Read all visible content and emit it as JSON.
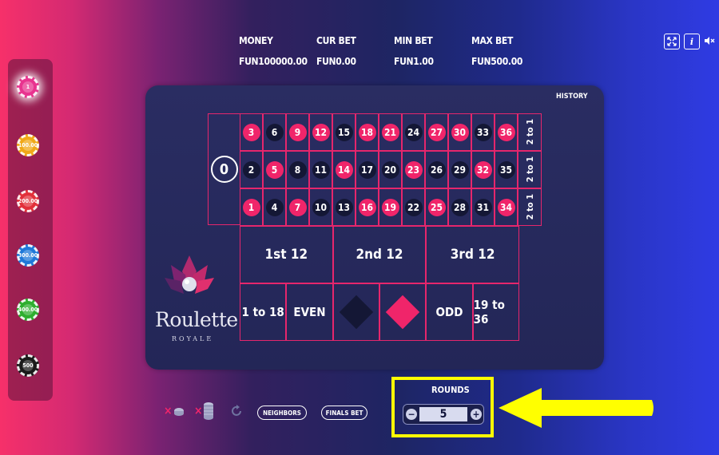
{
  "header": {
    "money_label": "MONEY",
    "money_value": "FUN100000.00",
    "curbet_label": "CUR BET",
    "curbet_value": "FUN0.00",
    "minbet_label": "MIN BET",
    "minbet_value": "FUN1.00",
    "maxbet_label": "MAX BET",
    "maxbet_value": "FUN500.00"
  },
  "toolbar": {
    "info_glyph": "i"
  },
  "chips": [
    {
      "value": "1",
      "color": "#e8348f"
    },
    {
      "value": "100.00",
      "color": "#f0a818"
    },
    {
      "value": "200.00",
      "color": "#e2303a"
    },
    {
      "value": "300.00",
      "color": "#1f78d8"
    },
    {
      "value": "400.00",
      "color": "#2eae2e"
    },
    {
      "value": "500",
      "color": "#1a1a1a"
    }
  ],
  "history_label": "HISTORY",
  "board": {
    "zero": "0",
    "rows": [
      [
        {
          "n": "3",
          "c": "red"
        },
        {
          "n": "6",
          "c": "black"
        },
        {
          "n": "9",
          "c": "red"
        },
        {
          "n": "12",
          "c": "red"
        },
        {
          "n": "15",
          "c": "black"
        },
        {
          "n": "18",
          "c": "red"
        },
        {
          "n": "21",
          "c": "red"
        },
        {
          "n": "24",
          "c": "black"
        },
        {
          "n": "27",
          "c": "red"
        },
        {
          "n": "30",
          "c": "red"
        },
        {
          "n": "33",
          "c": "black"
        },
        {
          "n": "36",
          "c": "red"
        }
      ],
      [
        {
          "n": "2",
          "c": "black"
        },
        {
          "n": "5",
          "c": "red"
        },
        {
          "n": "8",
          "c": "black"
        },
        {
          "n": "11",
          "c": "black"
        },
        {
          "n": "14",
          "c": "red"
        },
        {
          "n": "17",
          "c": "black"
        },
        {
          "n": "20",
          "c": "black"
        },
        {
          "n": "23",
          "c": "red"
        },
        {
          "n": "26",
          "c": "black"
        },
        {
          "n": "29",
          "c": "black"
        },
        {
          "n": "32",
          "c": "red"
        },
        {
          "n": "35",
          "c": "black"
        }
      ],
      [
        {
          "n": "1",
          "c": "red"
        },
        {
          "n": "4",
          "c": "black"
        },
        {
          "n": "7",
          "c": "red"
        },
        {
          "n": "10",
          "c": "black"
        },
        {
          "n": "13",
          "c": "black"
        },
        {
          "n": "16",
          "c": "red"
        },
        {
          "n": "19",
          "c": "red"
        },
        {
          "n": "22",
          "c": "black"
        },
        {
          "n": "25",
          "c": "red"
        },
        {
          "n": "28",
          "c": "black"
        },
        {
          "n": "31",
          "c": "black"
        },
        {
          "n": "34",
          "c": "red"
        }
      ]
    ],
    "column_bet": "2 to 1",
    "dozens": [
      "1st 12",
      "2nd 12",
      "3rd 12"
    ],
    "outside": {
      "low": "1 to 18",
      "even": "EVEN",
      "odd": "ODD",
      "high": "19 to 36"
    }
  },
  "logo": {
    "title": "Roulette",
    "subtitle": "ROYALE"
  },
  "controls": {
    "clear_glyph": "×",
    "neighbors_label": "NEIGHBORS",
    "finals_label": "FINALS BET",
    "rounds_label": "ROUNDS",
    "rounds_value": "5",
    "minus": "−",
    "plus": "+"
  },
  "colors": {
    "red": "#f0256a",
    "black": "#141735",
    "highlight": "#ffff00"
  }
}
